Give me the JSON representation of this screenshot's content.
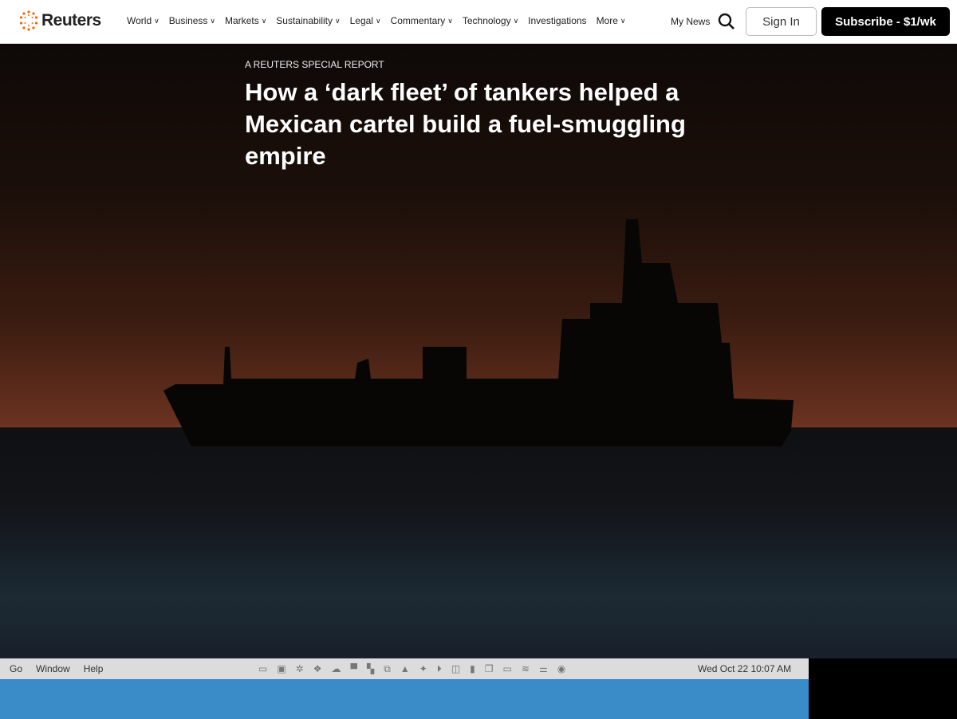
{
  "nav": {
    "brand": "Reuters",
    "items": [
      "World",
      "Business",
      "Markets",
      "Sustainability",
      "Legal",
      "Commentary",
      "Technology",
      "Investigations",
      "More"
    ],
    "has_chevron": [
      true,
      true,
      true,
      true,
      true,
      true,
      true,
      false,
      true
    ],
    "my_news": "My News",
    "sign_in": "Sign In",
    "subscribe": "Subscribe - $1/wk",
    "brand_color": "#fa6400"
  },
  "article": {
    "kicker": "A REUTERS SPECIAL REPORT",
    "headline": "How a ‘dark fleet’ of tankers helped a Mexican cartel build a fuel-smuggling empire"
  },
  "menubar": {
    "items": [
      "Go",
      "Window",
      "Help"
    ],
    "clock": "Wed Oct 22  10:07 AM"
  }
}
